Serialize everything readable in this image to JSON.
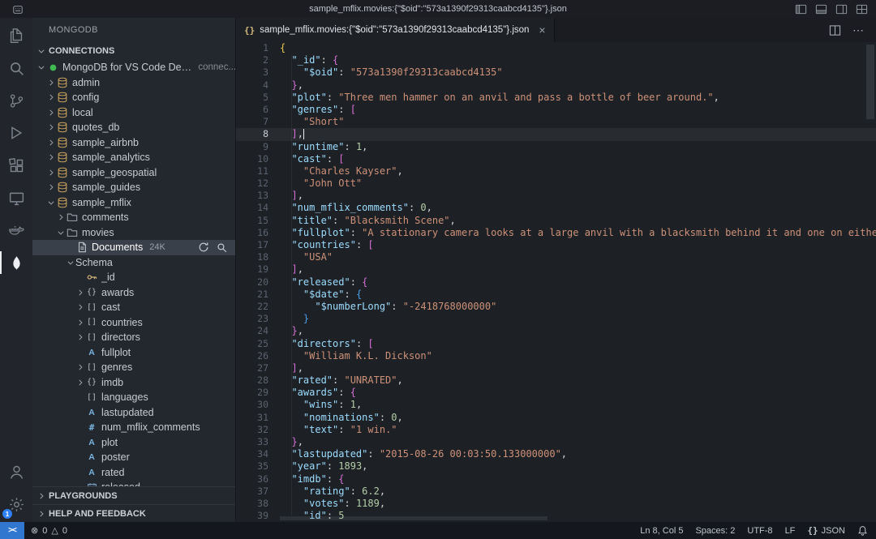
{
  "window": {
    "title": "sample_mflix.movies:{\"$oid\":\"573a1390f29313caabcd4135\"}.json"
  },
  "colors": {
    "accent_blue": "#3277cf",
    "mongo_green": "#3fb950",
    "badge_blue": "#2f81f7",
    "selection_bg": "#3a4049",
    "syntax_key": "#9cdcfe",
    "syntax_string": "#ce9178",
    "syntax_number": "#b5cea8",
    "bracket_level1": "#e8c64e",
    "bracket_level2": "#d670d6",
    "bracket_level3": "#4f9fe8"
  },
  "activity_bar": {
    "top": [
      {
        "name": "explorer",
        "icon": "files"
      },
      {
        "name": "search",
        "icon": "search"
      },
      {
        "name": "source-control",
        "icon": "source-control"
      },
      {
        "name": "run-debug",
        "icon": "debug"
      },
      {
        "name": "extensions",
        "icon": "extensions"
      },
      {
        "name": "remote-explorer",
        "icon": "remote"
      },
      {
        "name": "docker",
        "icon": "docker"
      },
      {
        "name": "mongodb",
        "icon": "leaf",
        "active": true
      }
    ],
    "bottom": [
      {
        "name": "account",
        "icon": "account"
      },
      {
        "name": "manage",
        "icon": "gear",
        "badge": "1"
      }
    ]
  },
  "sidebar": {
    "title": "MONGODB",
    "connections_header": "CONNECTIONS",
    "playgrounds_header": "PLAYGROUNDS",
    "help_header": "HELP AND FEEDBACK",
    "connection": {
      "label": "MongoDB for VS Code Demo",
      "description": "connec...",
      "status": "connected"
    },
    "databases": [
      "admin",
      "config",
      "local",
      "quotes_db",
      "sample_airbnb",
      "sample_analytics",
      "sample_geospatial",
      "sample_guides"
    ],
    "expanded_database": "sample_mflix",
    "collections": [
      {
        "name": "comments",
        "expanded": false
      },
      {
        "name": "movies",
        "expanded": true
      }
    ],
    "documents_row": {
      "label": "Documents",
      "count": "24K"
    },
    "schema_row": {
      "label": "Schema"
    },
    "schema_fields": [
      {
        "name": "_id",
        "type": "key",
        "expandable": false
      },
      {
        "name": "awards",
        "type": "object",
        "expandable": true
      },
      {
        "name": "cast",
        "type": "array",
        "expandable": true
      },
      {
        "name": "countries",
        "type": "array",
        "expandable": true
      },
      {
        "name": "directors",
        "type": "array",
        "expandable": true
      },
      {
        "name": "fullplot",
        "type": "string",
        "expandable": false
      },
      {
        "name": "genres",
        "type": "array",
        "expandable": true
      },
      {
        "name": "imdb",
        "type": "object",
        "expandable": true
      },
      {
        "name": "languages",
        "type": "array",
        "expandable": false
      },
      {
        "name": "lastupdated",
        "type": "string",
        "expandable": false
      },
      {
        "name": "num_mflix_comments",
        "type": "number",
        "expandable": false
      },
      {
        "name": "plot",
        "type": "string",
        "expandable": false
      },
      {
        "name": "poster",
        "type": "string",
        "expandable": false
      },
      {
        "name": "rated",
        "type": "string",
        "expandable": false
      },
      {
        "name": "released",
        "type": "date",
        "expandable": false
      }
    ]
  },
  "editor": {
    "tab": {
      "label": "sample_mflix.movies:{\"$oid\":\"573a1390f29313caabcd4135\"}.json"
    },
    "cursor": {
      "line": 8,
      "col": 5
    },
    "lines": [
      [
        [
          "b1",
          "{"
        ]
      ],
      [
        [
          "pl",
          "  "
        ],
        [
          "k",
          "\"_id\""
        ],
        [
          "pl",
          ": "
        ],
        [
          "b2",
          "{"
        ]
      ],
      [
        [
          "pl",
          "    "
        ],
        [
          "k",
          "\"$oid\""
        ],
        [
          "pl",
          ": "
        ],
        [
          "s",
          "\"573a1390f29313caabcd4135\""
        ]
      ],
      [
        [
          "pl",
          "  "
        ],
        [
          "b2",
          "}"
        ],
        [
          "pl",
          ","
        ]
      ],
      [
        [
          "pl",
          "  "
        ],
        [
          "k",
          "\"plot\""
        ],
        [
          "pl",
          ": "
        ],
        [
          "s",
          "\"Three men hammer on an anvil and pass a bottle of beer around.\""
        ],
        [
          "pl",
          ","
        ]
      ],
      [
        [
          "pl",
          "  "
        ],
        [
          "k",
          "\"genres\""
        ],
        [
          "pl",
          ": "
        ],
        [
          "b2",
          "["
        ]
      ],
      [
        [
          "pl",
          "    "
        ],
        [
          "s",
          "\"Short\""
        ]
      ],
      [
        [
          "pl",
          "  "
        ],
        [
          "b2",
          "]"
        ],
        [
          "pl",
          ","
        ]
      ],
      [
        [
          "pl",
          "  "
        ],
        [
          "k",
          "\"runtime\""
        ],
        [
          "pl",
          ": "
        ],
        [
          "n",
          "1"
        ],
        [
          "pl",
          ","
        ]
      ],
      [
        [
          "pl",
          "  "
        ],
        [
          "k",
          "\"cast\""
        ],
        [
          "pl",
          ": "
        ],
        [
          "b2",
          "["
        ]
      ],
      [
        [
          "pl",
          "    "
        ],
        [
          "s",
          "\"Charles Kayser\""
        ],
        [
          "pl",
          ","
        ]
      ],
      [
        [
          "pl",
          "    "
        ],
        [
          "s",
          "\"John Ott\""
        ]
      ],
      [
        [
          "pl",
          "  "
        ],
        [
          "b2",
          "]"
        ],
        [
          "pl",
          ","
        ]
      ],
      [
        [
          "pl",
          "  "
        ],
        [
          "k",
          "\"num_mflix_comments\""
        ],
        [
          "pl",
          ": "
        ],
        [
          "n",
          "0"
        ],
        [
          "pl",
          ","
        ]
      ],
      [
        [
          "pl",
          "  "
        ],
        [
          "k",
          "\"title\""
        ],
        [
          "pl",
          ": "
        ],
        [
          "s",
          "\"Blacksmith Scene\""
        ],
        [
          "pl",
          ","
        ]
      ],
      [
        [
          "pl",
          "  "
        ],
        [
          "k",
          "\"fullplot\""
        ],
        [
          "pl",
          ": "
        ],
        [
          "s",
          "\"A stationary camera looks at a large anvil with a blacksmith behind it and one on either side. The smith"
        ]
      ],
      [
        [
          "pl",
          "  "
        ],
        [
          "k",
          "\"countries\""
        ],
        [
          "pl",
          ": "
        ],
        [
          "b2",
          "["
        ]
      ],
      [
        [
          "pl",
          "    "
        ],
        [
          "s",
          "\"USA\""
        ]
      ],
      [
        [
          "pl",
          "  "
        ],
        [
          "b2",
          "]"
        ],
        [
          "pl",
          ","
        ]
      ],
      [
        [
          "pl",
          "  "
        ],
        [
          "k",
          "\"released\""
        ],
        [
          "pl",
          ": "
        ],
        [
          "b2",
          "{"
        ]
      ],
      [
        [
          "pl",
          "    "
        ],
        [
          "k",
          "\"$date\""
        ],
        [
          "pl",
          ": "
        ],
        [
          "b3",
          "{"
        ]
      ],
      [
        [
          "pl",
          "      "
        ],
        [
          "k",
          "\"$numberLong\""
        ],
        [
          "pl",
          ": "
        ],
        [
          "s",
          "\"-2418768000000\""
        ]
      ],
      [
        [
          "pl",
          "    "
        ],
        [
          "b3",
          "}"
        ]
      ],
      [
        [
          "pl",
          "  "
        ],
        [
          "b2",
          "}"
        ],
        [
          "pl",
          ","
        ]
      ],
      [
        [
          "pl",
          "  "
        ],
        [
          "k",
          "\"directors\""
        ],
        [
          "pl",
          ": "
        ],
        [
          "b2",
          "["
        ]
      ],
      [
        [
          "pl",
          "    "
        ],
        [
          "s",
          "\"William K.L. Dickson\""
        ]
      ],
      [
        [
          "pl",
          "  "
        ],
        [
          "b2",
          "]"
        ],
        [
          "pl",
          ","
        ]
      ],
      [
        [
          "pl",
          "  "
        ],
        [
          "k",
          "\"rated\""
        ],
        [
          "pl",
          ": "
        ],
        [
          "s",
          "\"UNRATED\""
        ],
        [
          "pl",
          ","
        ]
      ],
      [
        [
          "pl",
          "  "
        ],
        [
          "k",
          "\"awards\""
        ],
        [
          "pl",
          ": "
        ],
        [
          "b2",
          "{"
        ]
      ],
      [
        [
          "pl",
          "    "
        ],
        [
          "k",
          "\"wins\""
        ],
        [
          "pl",
          ": "
        ],
        [
          "n",
          "1"
        ],
        [
          "pl",
          ","
        ]
      ],
      [
        [
          "pl",
          "    "
        ],
        [
          "k",
          "\"nominations\""
        ],
        [
          "pl",
          ": "
        ],
        [
          "n",
          "0"
        ],
        [
          "pl",
          ","
        ]
      ],
      [
        [
          "pl",
          "    "
        ],
        [
          "k",
          "\"text\""
        ],
        [
          "pl",
          ": "
        ],
        [
          "s",
          "\"1 win.\""
        ]
      ],
      [
        [
          "pl",
          "  "
        ],
        [
          "b2",
          "}"
        ],
        [
          "pl",
          ","
        ]
      ],
      [
        [
          "pl",
          "  "
        ],
        [
          "k",
          "\"lastupdated\""
        ],
        [
          "pl",
          ": "
        ],
        [
          "s",
          "\"2015-08-26 00:03:50.133000000\""
        ],
        [
          "pl",
          ","
        ]
      ],
      [
        [
          "pl",
          "  "
        ],
        [
          "k",
          "\"year\""
        ],
        [
          "pl",
          ": "
        ],
        [
          "n",
          "1893"
        ],
        [
          "pl",
          ","
        ]
      ],
      [
        [
          "pl",
          "  "
        ],
        [
          "k",
          "\"imdb\""
        ],
        [
          "pl",
          ": "
        ],
        [
          "b2",
          "{"
        ]
      ],
      [
        [
          "pl",
          "    "
        ],
        [
          "k",
          "\"rating\""
        ],
        [
          "pl",
          ": "
        ],
        [
          "n",
          "6.2"
        ],
        [
          "pl",
          ","
        ]
      ],
      [
        [
          "pl",
          "    "
        ],
        [
          "k",
          "\"votes\""
        ],
        [
          "pl",
          ": "
        ],
        [
          "n",
          "1189"
        ],
        [
          "pl",
          ","
        ]
      ],
      [
        [
          "pl",
          "    "
        ],
        [
          "k",
          "\"id\""
        ],
        [
          "pl",
          ": "
        ],
        [
          "n",
          "5"
        ]
      ]
    ]
  },
  "status_bar": {
    "remote_label": "><",
    "errors": "0",
    "warnings": "0",
    "cursor_position": "Ln 8, Col 5",
    "indentation": "Spaces: 2",
    "encoding": "UTF-8",
    "eol": "LF",
    "language": "JSON",
    "language_glyph": "{}"
  }
}
